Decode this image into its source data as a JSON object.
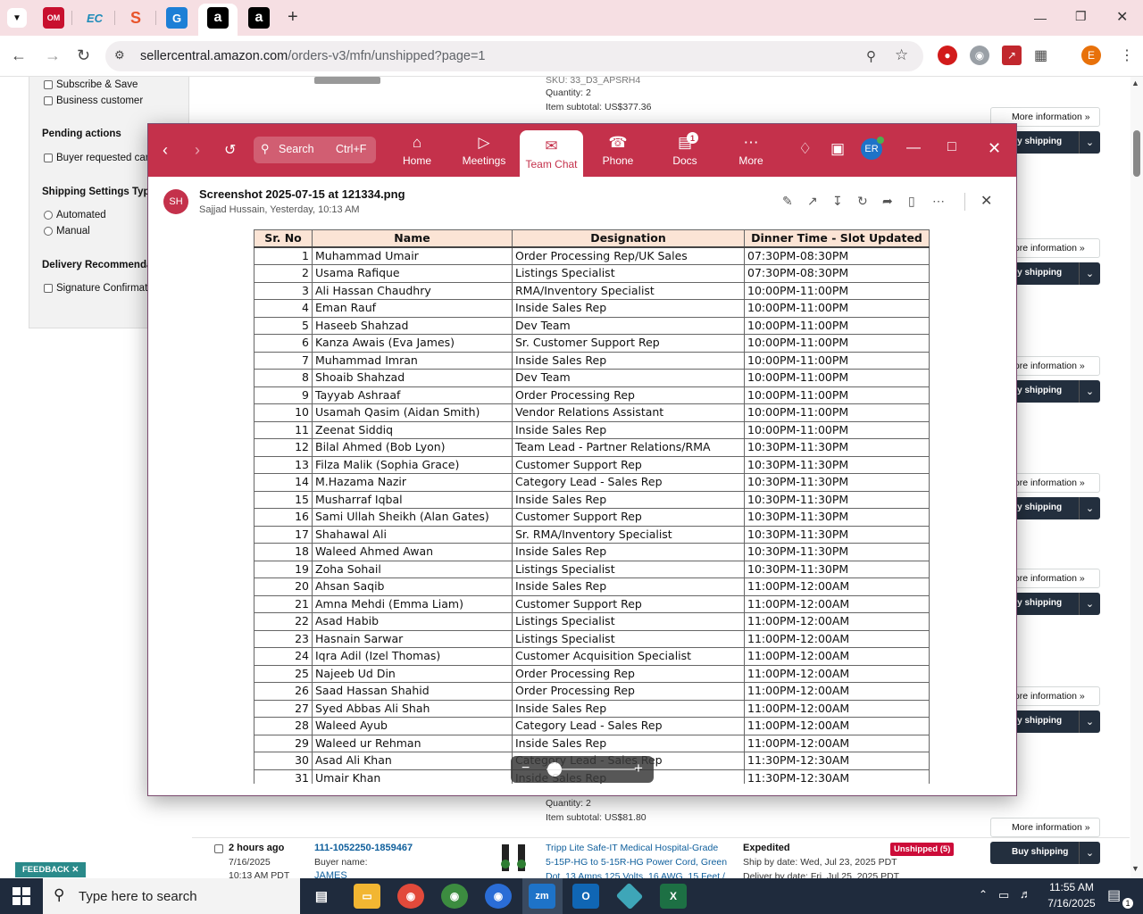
{
  "browser": {
    "url_host": "sellercentral.amazon.com",
    "url_path": "/orders-v3/mfn/unshipped?page=1",
    "tabs": [
      "OM",
      "EC",
      "S",
      "G",
      "a",
      "a"
    ],
    "new_tab": "+",
    "profile": "E"
  },
  "amazon": {
    "filters": {
      "subscribe_save": "Subscribe & Save",
      "business_customer": "Business customer",
      "pending_actions": "Pending actions",
      "buyer_requested": "Buyer requested can",
      "shipping_settings": "Shipping Settings Type",
      "automated": "Automated",
      "manual": "Manual",
      "delivery_rec": "Delivery Recommenda",
      "signature": "Signature Confirmat"
    },
    "top_order": {
      "sku": "SKU: 33_D3_APSRH4",
      "quantity": "Quantity: 2",
      "subtotal": "Item subtotal: US$377.36"
    },
    "more_information": "More information",
    "more_information_cut": "fore information",
    "buy_shipping": "Buy shipping",
    "buy_shipping_cut": "uy shipping",
    "bottom_order": {
      "quantity": "Quantity: 2",
      "subtotal": "Item subtotal: US$81.80",
      "age": "2 hours ago",
      "date": "7/16/2025",
      "time": "10:13 AM PDT",
      "order_id": "111-1052250-1859467",
      "buyer_label": "Buyer name:",
      "buyer": "JAMES",
      "product_line1": "Tripp Lite Safe-IT Medical Hospital-Grade",
      "product_line2": "5-15P-HG to 5-15R-HG Power Cord, Green",
      "product_line3": "Dot, 13 Amps 125 Volts, 16 AWG, 15 Feet /",
      "service": "Expedited",
      "ship_by": "Ship by date: Wed, Jul 23, 2025 PDT",
      "deliver_by": "Deliver by date: Fri, Jul 25, 2025 PDT",
      "status": "Unshipped (5)"
    },
    "feedback": "FEEDBACK"
  },
  "teams": {
    "search": "Search",
    "shortcut": "Ctrl+F",
    "nav": [
      {
        "label": "Home",
        "icon": "home-icon"
      },
      {
        "label": "Meetings",
        "icon": "video-icon"
      },
      {
        "label": "Team Chat",
        "icon": "chat-icon"
      },
      {
        "label": "Phone",
        "icon": "phone-icon"
      },
      {
        "label": "Docs",
        "icon": "docs-icon"
      },
      {
        "label": "More",
        "icon": "more-icon"
      }
    ],
    "docs_badge": "1",
    "user_initials": "ER",
    "file": {
      "title": "Screenshot 2025-07-15 at 121334.png",
      "meta": "Sajjad Hussain, Yesterday, 10:13 AM",
      "sender_initials": "SH"
    }
  },
  "table": {
    "headers": [
      "Sr. No",
      "Name",
      "Designation",
      "Dinner Time - Slot Updated"
    ],
    "rows": [
      [
        "1",
        "Muhammad Umair",
        "Order Processing Rep/UK Sales",
        "07:30PM-08:30PM"
      ],
      [
        "2",
        "Usama Rafique",
        "Listings Specialist",
        "07:30PM-08:30PM"
      ],
      [
        "3",
        "Ali Hassan Chaudhry",
        "RMA/Inventory Specialist",
        "10:00PM-11:00PM"
      ],
      [
        "4",
        "Eman Rauf",
        "Inside Sales Rep",
        "10:00PM-11:00PM"
      ],
      [
        "5",
        "Haseeb Shahzad",
        "Dev Team",
        "10:00PM-11:00PM"
      ],
      [
        "6",
        "Kanza Awais (Eva James)",
        "Sr. Customer Support Rep",
        "10:00PM-11:00PM"
      ],
      [
        "7",
        "Muhammad Imran",
        "Inside Sales Rep",
        "10:00PM-11:00PM"
      ],
      [
        "8",
        "Shoaib Shahzad",
        "Dev Team",
        "10:00PM-11:00PM"
      ],
      [
        "9",
        "Tayyab Ashraaf",
        "Order Processing Rep",
        "10:00PM-11:00PM"
      ],
      [
        "10",
        "Usamah Qasim (Aidan Smith)",
        "Vendor Relations Assistant",
        "10:00PM-11:00PM"
      ],
      [
        "11",
        "Zeenat Siddiq",
        "Inside Sales Rep",
        "10:00PM-11:00PM"
      ],
      [
        "12",
        "Bilal Ahmed (Bob Lyon)",
        "Team Lead - Partner Relations/RMA",
        "10:30PM-11:30PM"
      ],
      [
        "13",
        "Filza Malik (Sophia Grace)",
        "Customer Support Rep",
        "10:30PM-11:30PM"
      ],
      [
        "14",
        "M.Hazama Nazir",
        "Category Lead - Sales Rep",
        "10:30PM-11:30PM"
      ],
      [
        "15",
        "Musharraf Iqbal",
        "Inside Sales Rep",
        "10:30PM-11:30PM"
      ],
      [
        "16",
        "Sami Ullah Sheikh (Alan Gates)",
        "Customer Support Rep",
        "10:30PM-11:30PM"
      ],
      [
        "17",
        "Shahawal Ali",
        "Sr. RMA/Inventory Specialist",
        "10:30PM-11:30PM"
      ],
      [
        "18",
        "Waleed Ahmed Awan",
        "Inside Sales Rep",
        "10:30PM-11:30PM"
      ],
      [
        "19",
        "Zoha Sohail",
        "Listings Specialist",
        "10:30PM-11:30PM"
      ],
      [
        "20",
        "Ahsan Saqib",
        "Inside Sales Rep",
        "11:00PM-12:00AM"
      ],
      [
        "21",
        "Amna Mehdi (Emma Liam)",
        "Customer Support Rep",
        "11:00PM-12:00AM"
      ],
      [
        "22",
        "Asad Habib",
        "Listings Specialist",
        "11:00PM-12:00AM"
      ],
      [
        "23",
        "Hasnain Sarwar",
        "Listings Specialist",
        "11:00PM-12:00AM"
      ],
      [
        "24",
        "Iqra Adil (Izel Thomas)",
        "Customer Acquisition Specialist",
        "11:00PM-12:00AM"
      ],
      [
        "25",
        "Najeeb Ud Din",
        "Order Processing Rep",
        "11:00PM-12:00AM"
      ],
      [
        "26",
        "Saad Hassan Shahid",
        "Order Processing Rep",
        "11:00PM-12:00AM"
      ],
      [
        "27",
        "Syed Abbas Ali Shah",
        "Inside Sales Rep",
        "11:00PM-12:00AM"
      ],
      [
        "28",
        "Waleed Ayub",
        "Category Lead - Sales Rep",
        "11:00PM-12:00AM"
      ],
      [
        "29",
        "Waleed ur Rehman",
        "Inside Sales Rep",
        "11:00PM-12:00AM"
      ],
      [
        "30",
        "Asad Ali Khan",
        "Category Lead - Sales Rep",
        "11:30PM-12:30AM"
      ],
      [
        "31",
        "Umair Khan",
        "Inside Sales Rep",
        "11:30PM-12:30AM"
      ]
    ]
  },
  "taskbar": {
    "search_placeholder": "Type here to search",
    "time": "11:55 AM",
    "date": "7/16/2025",
    "notification_count": "1"
  },
  "colors": {
    "teams_accent": "#c4314b",
    "amazon_dark": "#232f3e",
    "header_fill": "#fbe4d5"
  }
}
